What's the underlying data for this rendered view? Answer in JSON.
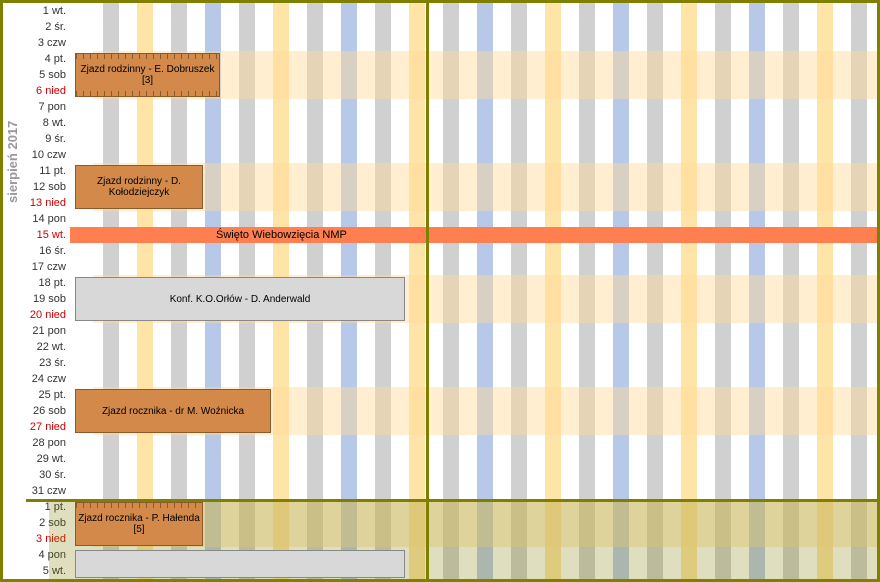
{
  "month_label": "sierpień 2017",
  "days": [
    {
      "n": "1",
      "d": "wt.",
      "type": ""
    },
    {
      "n": "2",
      "d": "śr.",
      "type": ""
    },
    {
      "n": "3",
      "d": "czw",
      "type": ""
    },
    {
      "n": "4",
      "d": "pt.",
      "type": "we"
    },
    {
      "n": "5",
      "d": "sob",
      "type": "we"
    },
    {
      "n": "6",
      "d": "nied",
      "type": "sun"
    },
    {
      "n": "7",
      "d": "pon",
      "type": ""
    },
    {
      "n": "8",
      "d": "wt.",
      "type": ""
    },
    {
      "n": "9",
      "d": "śr.",
      "type": ""
    },
    {
      "n": "10",
      "d": "czw",
      "type": ""
    },
    {
      "n": "11",
      "d": "pt.",
      "type": "we"
    },
    {
      "n": "12",
      "d": "sob",
      "type": "we"
    },
    {
      "n": "13",
      "d": "nied",
      "type": "sun"
    },
    {
      "n": "14",
      "d": "pon",
      "type": ""
    },
    {
      "n": "15",
      "d": "wt.",
      "type": "hol"
    },
    {
      "n": "16",
      "d": "śr.",
      "type": ""
    },
    {
      "n": "17",
      "d": "czw",
      "type": ""
    },
    {
      "n": "18",
      "d": "pt.",
      "type": "we"
    },
    {
      "n": "19",
      "d": "sob",
      "type": "we"
    },
    {
      "n": "20",
      "d": "nied",
      "type": "sun"
    },
    {
      "n": "21",
      "d": "pon",
      "type": ""
    },
    {
      "n": "22",
      "d": "wt.",
      "type": ""
    },
    {
      "n": "23",
      "d": "śr.",
      "type": ""
    },
    {
      "n": "24",
      "d": "czw",
      "type": ""
    },
    {
      "n": "25",
      "d": "pt.",
      "type": "we"
    },
    {
      "n": "26",
      "d": "sob",
      "type": "we"
    },
    {
      "n": "27",
      "d": "nied",
      "type": "sun"
    },
    {
      "n": "28",
      "d": "pon",
      "type": ""
    },
    {
      "n": "29",
      "d": "wt.",
      "type": ""
    },
    {
      "n": "30",
      "d": "śr.",
      "type": ""
    },
    {
      "n": "31",
      "d": "czw",
      "type": ""
    },
    {
      "n": "1",
      "d": "pt.",
      "type": "we"
    },
    {
      "n": "2",
      "d": "sob",
      "type": "we"
    },
    {
      "n": "3",
      "d": "nied",
      "type": "sun"
    },
    {
      "n": "4",
      "d": "pon",
      "type": ""
    },
    {
      "n": "5",
      "d": "wt.",
      "type": ""
    }
  ],
  "holiday_text": "Święto Wiebowzięcia NMP",
  "events": {
    "e1": "Zjazd rodzinny - E. Dobruszek [3]",
    "e2": "Zjazd rodzinny - D. Kołodziejczyk",
    "e3": "Konf. K.O.Orłów - D. Anderwald",
    "e4": "Zjazd rocznika - dr M. Woźnicka",
    "e5": "Zjazd rocznika - P. Hałenda [5]"
  }
}
